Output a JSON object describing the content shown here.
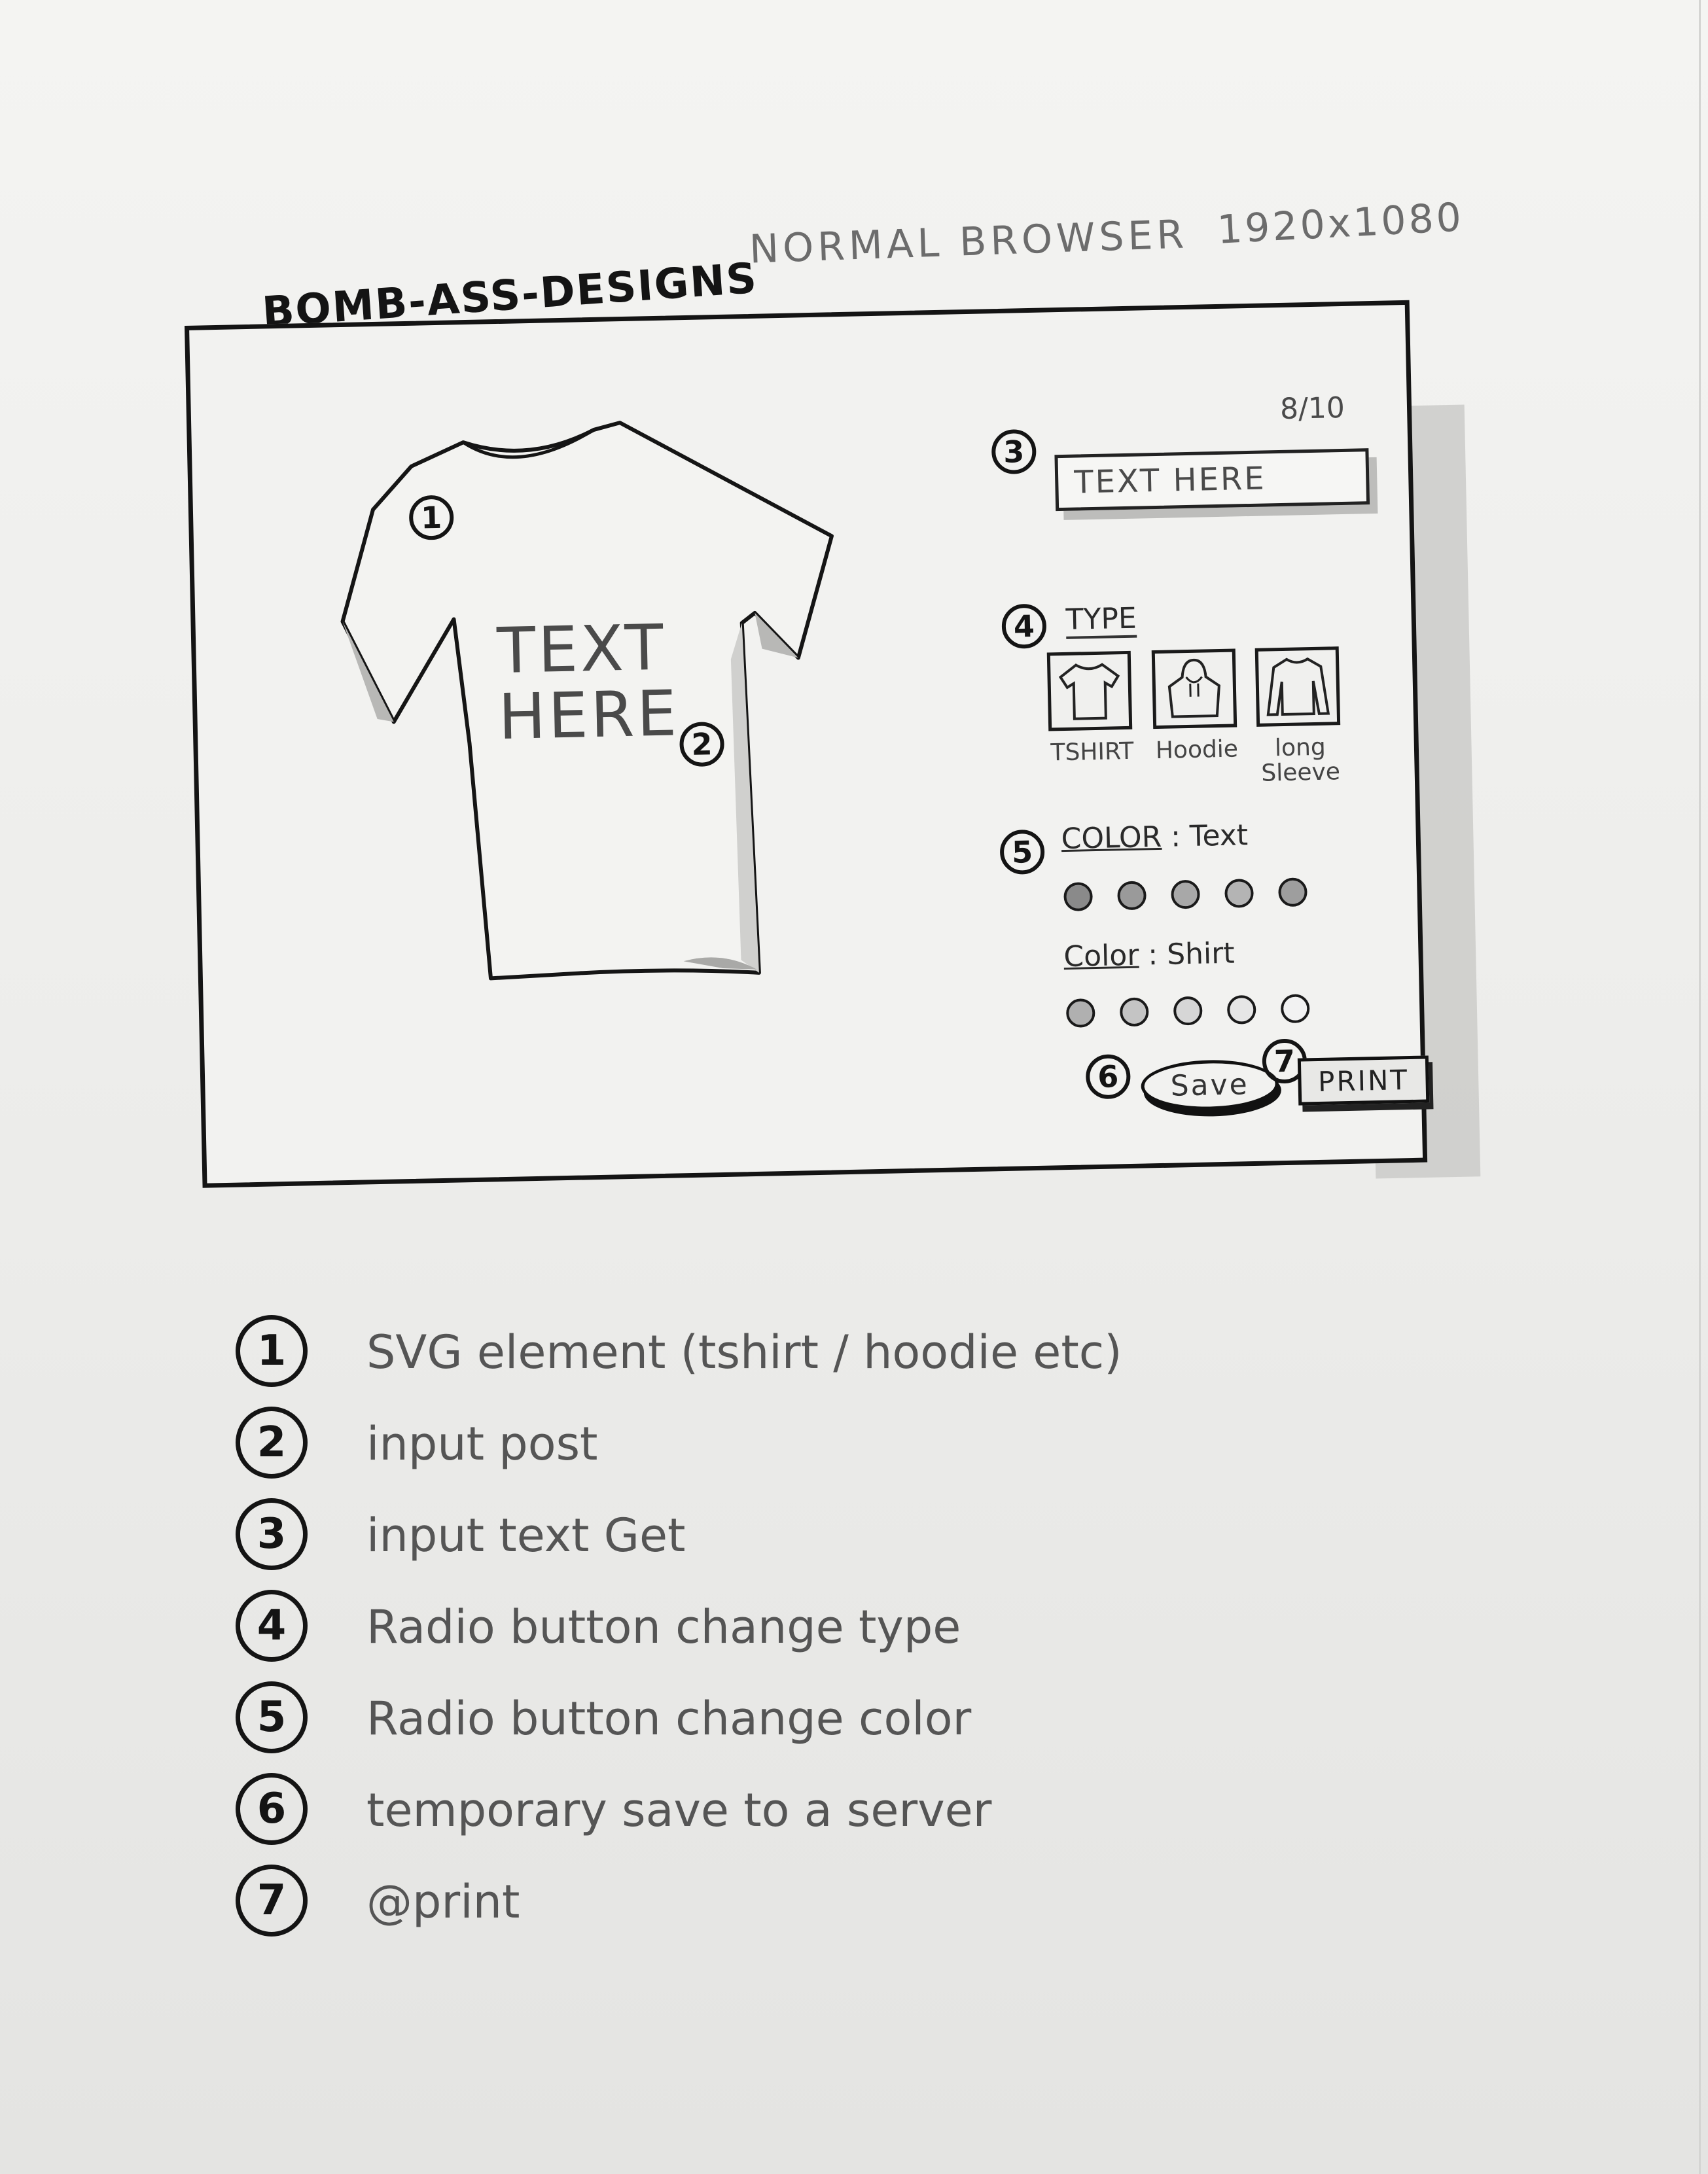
{
  "header": {
    "brand": "BOMB-ASS-DESIGNS",
    "browser_note": "NORMAL BROWSER",
    "resolution": "1920x1080"
  },
  "preview": {
    "shirt_text_line1": "TEXT",
    "shirt_text_line2": "HERE",
    "marker_1": "1",
    "marker_2": "2"
  },
  "controls": {
    "char_count": "8/10",
    "text_input": {
      "value": "TEXT HERE",
      "marker": "3"
    },
    "type": {
      "label": "TYPE",
      "marker": "4",
      "options": [
        {
          "label": "TSHIRT",
          "icon": "tshirt-icon"
        },
        {
          "label": "Hoodie",
          "icon": "hoodie-icon"
        },
        {
          "label": "long Sleeve",
          "icon": "long-sleeve-icon"
        }
      ]
    },
    "color_text": {
      "label": "COLOR",
      "suffix": ": Text",
      "marker": "5",
      "swatches": [
        "#8a8a8a",
        "#9a9a9a",
        "#a8a8a8",
        "#b4b4b4",
        "#9e9e9e"
      ]
    },
    "color_shirt": {
      "label": "Color",
      "suffix": ": Shirt",
      "swatches": [
        "#b0b0b0",
        "#c4c4c4",
        "#d6d6d6",
        "#e6e6e6",
        "#f2f2f2"
      ]
    },
    "save": {
      "label": "Save",
      "marker": "6"
    },
    "print": {
      "label": "PRINT",
      "marker": "7"
    }
  },
  "legend": [
    {
      "num": "1",
      "text": "SVG element (tshirt / hoodie etc)"
    },
    {
      "num": "2",
      "text": "input post"
    },
    {
      "num": "3",
      "text": "input text Get"
    },
    {
      "num": "4",
      "text": "Radio button change type"
    },
    {
      "num": "5",
      "text": "Radio button change color"
    },
    {
      "num": "6",
      "text": "temporary save to a server"
    },
    {
      "num": "7",
      "text": "@print"
    }
  ]
}
